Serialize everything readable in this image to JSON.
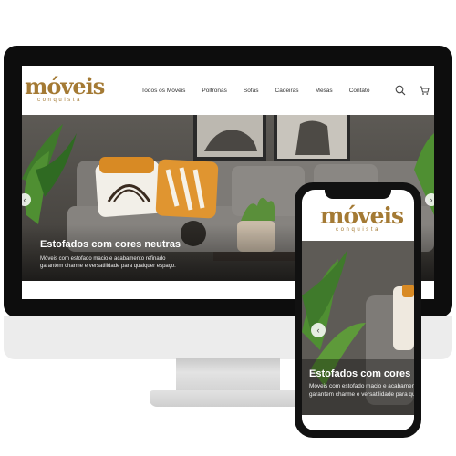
{
  "brand": {
    "name": "móveis",
    "tagline": "conquista",
    "color": "#a47a34"
  },
  "nav": {
    "items": [
      "Todos os Móveis",
      "Poltronas",
      "Sofás",
      "Cadeiras",
      "Mesas",
      "Contato"
    ],
    "icons": [
      "search-icon",
      "cart-icon"
    ]
  },
  "hero": {
    "title": "Estofados com cores neutras",
    "text_line1": "Móveis com estofado macio e acabamento refinado",
    "text_line2": "garantem charme e versatilidade para qualquer espaço."
  },
  "mobile": {
    "title": "Estofados com cores neutras",
    "text_line1": "Móveis com estofado macio e acabamento refinado",
    "text_line2": "garantem charme e versatilidade para qualquer espaço."
  }
}
